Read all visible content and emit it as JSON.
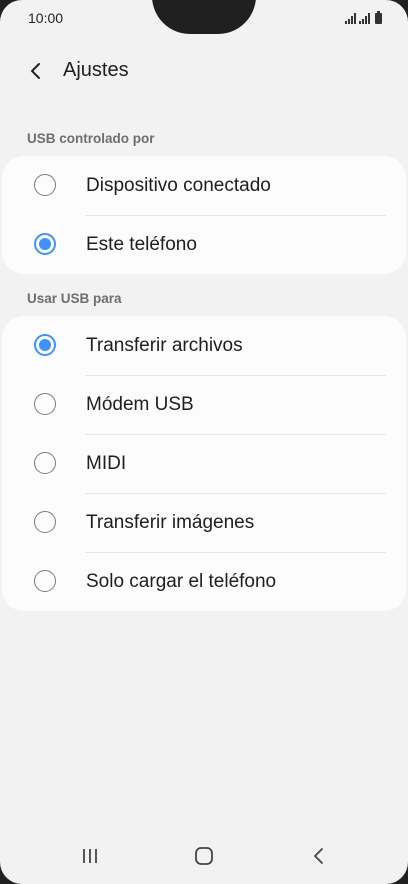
{
  "status_bar": {
    "time": "10:00",
    "icons": [
      "signal-icon",
      "signal-icon",
      "battery-icon"
    ]
  },
  "header": {
    "title": "Ajustes",
    "back_icon": "chevron-left-icon"
  },
  "usb_controlled_by": {
    "label": "USB controlado por",
    "options": [
      {
        "label": "Dispositivo conectado",
        "selected": false
      },
      {
        "label": "Este teléfono",
        "selected": true
      }
    ]
  },
  "use_usb_for": {
    "label": "Usar USB para",
    "options": [
      {
        "label": "Transferir archivos",
        "selected": true
      },
      {
        "label": "Módem USB",
        "selected": false
      },
      {
        "label": "MIDI",
        "selected": false
      },
      {
        "label": "Transferir imágenes",
        "selected": false
      },
      {
        "label": "Solo cargar el teléfono",
        "selected": false
      }
    ]
  },
  "nav_bar": {
    "buttons": [
      "recent-apps-icon",
      "home-icon",
      "back-icon"
    ]
  },
  "colors": {
    "accent": "#3e91ff",
    "background": "#f2f2f2",
    "card": "#fcfcfc"
  }
}
